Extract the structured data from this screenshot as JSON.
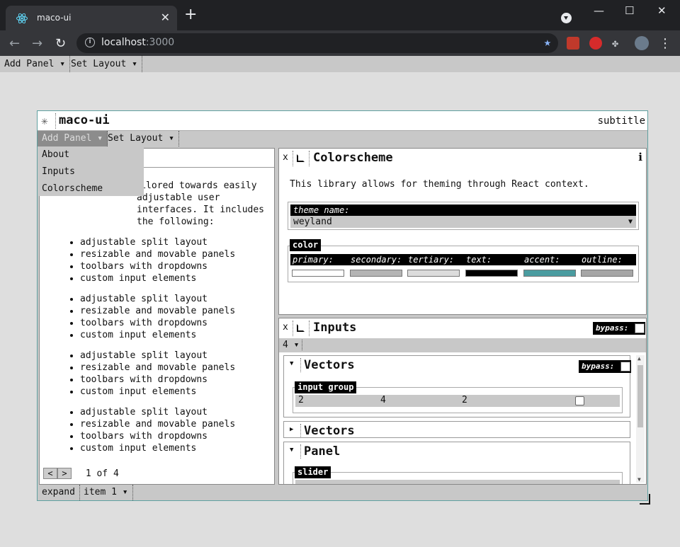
{
  "browser": {
    "tab_title": "maco-ui",
    "tab_close": "✕",
    "new_tab": "+",
    "url_host": "localhost",
    "url_port": ":3000",
    "back": "←",
    "forward": "→",
    "reload": "↻",
    "star": "★",
    "minimize": "—",
    "maximize": "☐",
    "close": "✕",
    "menu": "⋮",
    "colors": {
      "frame": "#202124",
      "toolbar": "#35363a",
      "accent": "#8ab4f8"
    }
  },
  "app_menubar": {
    "add_panel": "Add Panel ▾",
    "set_layout": "Set Layout ▾"
  },
  "window": {
    "icon": "✳",
    "title": "maco-ui",
    "subtitle": "subtitle",
    "menu": {
      "add_panel": "Add Panel ▾",
      "set_layout": "Set Layout ▾"
    },
    "dropdown_items": [
      "About",
      "Inputs",
      "Colorscheme"
    ],
    "statusbar": {
      "expand": "expand",
      "item": "item 1 ▾"
    }
  },
  "about_panel": {
    "intro_visible": "onent library tailored towards easily adjustable user interfaces. It includes the following:",
    "lists": [
      [
        "adjustable split layout",
        "resizable and movable panels",
        "toolbars with dropdowns",
        "custom input elements"
      ],
      [
        "adjustable split layout",
        "resizable and movable panels",
        "toolbars with dropdowns",
        "custom input elements"
      ],
      [
        "adjustable split layout",
        "resizable and movable panels",
        "toolbars with dropdowns",
        "custom input elements"
      ],
      [
        "adjustable split layout",
        "resizable and movable panels",
        "toolbars with dropdowns",
        "custom input elements"
      ]
    ],
    "pager": {
      "prev": "<",
      "next": ">",
      "info": "1 of 4"
    }
  },
  "colorscheme_panel": {
    "close": "x",
    "title": "Colorscheme",
    "info": "i",
    "description": "This library allows for theming through React context.",
    "theme_label": "theme name:",
    "theme_value": "weyland",
    "color_legend": "color",
    "swatches": [
      {
        "label": "primary:",
        "color": "#ffffff"
      },
      {
        "label": "secondary:",
        "color": "#b4b4b4"
      },
      {
        "label": "tertiary:",
        "color": "#dcdcdc"
      },
      {
        "label": "text:",
        "color": "#000000"
      },
      {
        "label": "accent:",
        "color": "#4a9ca0"
      },
      {
        "label": "outline:",
        "color": "#a6a6a6"
      }
    ]
  },
  "inputs_panel": {
    "close": "x",
    "title": "Inputs",
    "bypass": "bypass:",
    "toolbar_value": "4 ▾",
    "sections": [
      {
        "title": "Vectors",
        "expanded": true,
        "bypass": "bypass:",
        "group_legend": "input group",
        "values": [
          "2",
          "4",
          "2"
        ]
      },
      {
        "title": "Vectors",
        "expanded": false
      },
      {
        "title": "Panel",
        "expanded": true,
        "legend": "slider"
      }
    ]
  }
}
